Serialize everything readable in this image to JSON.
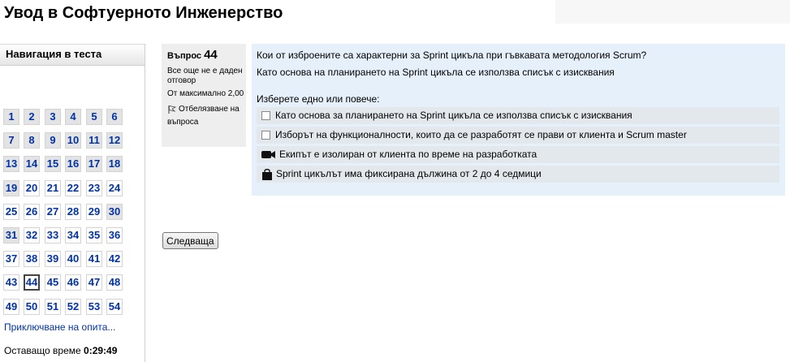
{
  "page": {
    "title": "Увод в Софтуерното Инженерство"
  },
  "nav": {
    "header": "Навигация в теста",
    "questions": [
      {
        "label": "1",
        "state": "answered"
      },
      {
        "label": "2",
        "state": "answered"
      },
      {
        "label": "3",
        "state": "answered"
      },
      {
        "label": "4",
        "state": "answered"
      },
      {
        "label": "5",
        "state": "answered"
      },
      {
        "label": "6",
        "state": "answered"
      },
      {
        "label": "7",
        "state": "answered"
      },
      {
        "label": "8",
        "state": "answered"
      },
      {
        "label": "9",
        "state": "answered"
      },
      {
        "label": "10",
        "state": "answered"
      },
      {
        "label": "11",
        "state": "answered"
      },
      {
        "label": "12",
        "state": "answered"
      },
      {
        "label": "13",
        "state": "answered"
      },
      {
        "label": "14",
        "state": "answered"
      },
      {
        "label": "15",
        "state": "answered"
      },
      {
        "label": "16",
        "state": "answered"
      },
      {
        "label": "17",
        "state": "answered"
      },
      {
        "label": "18",
        "state": "answered"
      },
      {
        "label": "19",
        "state": "answered"
      },
      {
        "label": "20",
        "state": "empty"
      },
      {
        "label": "21",
        "state": "empty"
      },
      {
        "label": "22",
        "state": "empty"
      },
      {
        "label": "23",
        "state": "empty"
      },
      {
        "label": "24",
        "state": "empty"
      },
      {
        "label": "25",
        "state": "empty"
      },
      {
        "label": "26",
        "state": "empty"
      },
      {
        "label": "27",
        "state": "empty"
      },
      {
        "label": "28",
        "state": "empty"
      },
      {
        "label": "29",
        "state": "empty"
      },
      {
        "label": "30",
        "state": "answered"
      },
      {
        "label": "31",
        "state": "answered"
      },
      {
        "label": "32",
        "state": "empty"
      },
      {
        "label": "33",
        "state": "empty"
      },
      {
        "label": "34",
        "state": "empty"
      },
      {
        "label": "35",
        "state": "empty"
      },
      {
        "label": "36",
        "state": "empty"
      },
      {
        "label": "37",
        "state": "empty"
      },
      {
        "label": "38",
        "state": "empty"
      },
      {
        "label": "39",
        "state": "empty"
      },
      {
        "label": "40",
        "state": "empty"
      },
      {
        "label": "41",
        "state": "empty"
      },
      {
        "label": "42",
        "state": "empty"
      },
      {
        "label": "43",
        "state": "empty"
      },
      {
        "label": "44",
        "state": "current"
      },
      {
        "label": "45",
        "state": "empty"
      },
      {
        "label": "46",
        "state": "empty"
      },
      {
        "label": "47",
        "state": "empty"
      },
      {
        "label": "48",
        "state": "empty"
      },
      {
        "label": "49",
        "state": "empty"
      },
      {
        "label": "50",
        "state": "empty"
      },
      {
        "label": "51",
        "state": "empty"
      },
      {
        "label": "52",
        "state": "empty"
      },
      {
        "label": "53",
        "state": "empty"
      },
      {
        "label": "54",
        "state": "empty"
      }
    ],
    "finish_link": "Приключване на опита...",
    "time_label": "Оставащо време",
    "time_value": "0:29:49"
  },
  "qinfo": {
    "prefix": "Въпрос",
    "number": "44",
    "state": "Все още не е даден отговор",
    "grade": "От максимално 2,00",
    "flag_label": "Отбелязване на въпроса",
    "flag_icon": "flag-icon"
  },
  "question": {
    "text": "Кои от изброените са характерни за Sprint цикъла при гъвкавата методология Scrum?",
    "subtext": "Като основа на планирането на Sprint цикъла се използва списък с изисквания",
    "prompt": "Изберете едно или повече:",
    "answers": [
      {
        "label": "Като основа за планирането на Sprint цикъла се използва списък с изисквания",
        "control": "checkbox",
        "icon": "checkbox"
      },
      {
        "label": "Изборът на функционалности, които да се разработят се прави от клиента и Scrum master",
        "control": "checkbox",
        "icon": "checkbox"
      },
      {
        "label": "Екипът е изолиран от клиента по време на разработката",
        "control": "icon",
        "icon": "video-camera-icon"
      },
      {
        "label": "Sprint цикълът има фиксирана дължина от 2 до 4 седмици",
        "control": "icon",
        "icon": "shopping-bag-icon"
      }
    ]
  },
  "buttons": {
    "next": "Следваща"
  },
  "colors": {
    "link": "#0033aa",
    "content_bg": "#e6f0fa",
    "info_bg": "#eeeeee",
    "answered_bg": "#e3e3e3"
  }
}
